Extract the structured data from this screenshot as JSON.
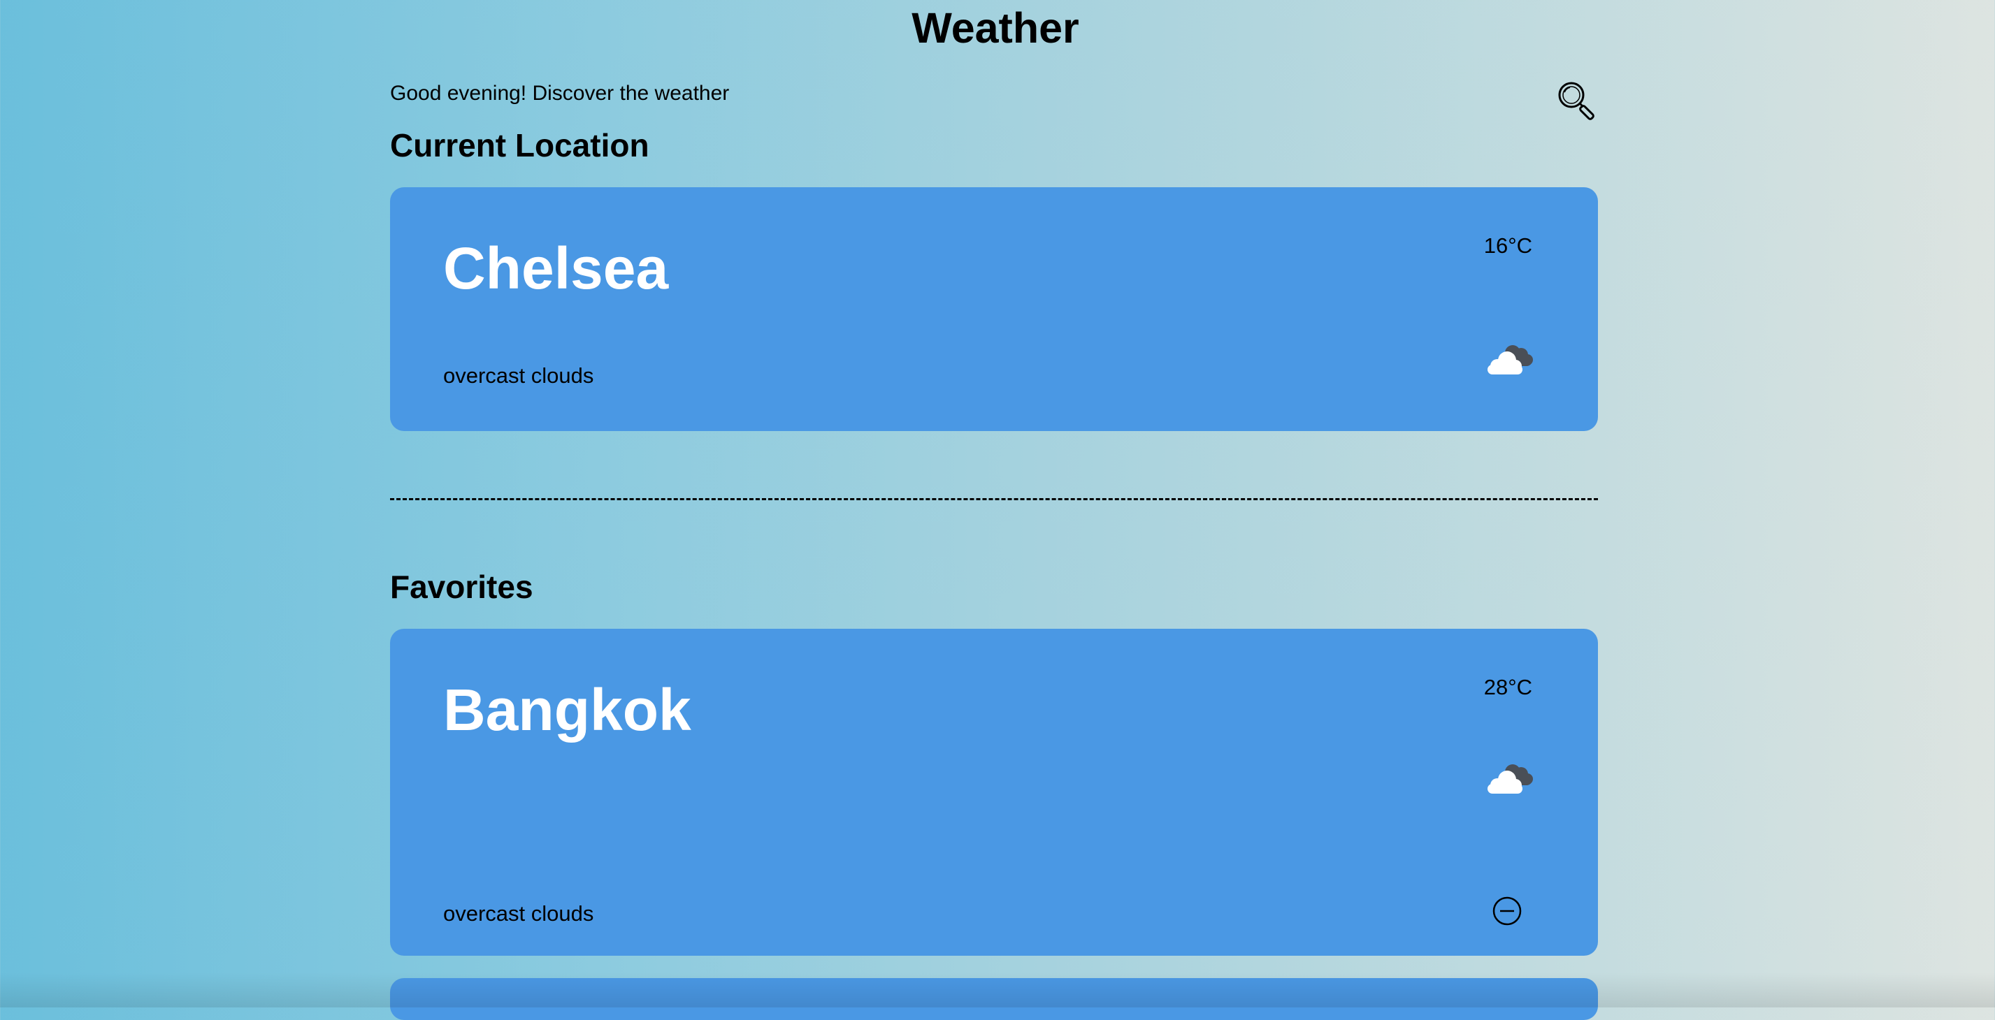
{
  "header": {
    "title": "Weather",
    "greeting": "Good evening! Discover the weather",
    "search_icon": "magnifying-glass-icon"
  },
  "current_location": {
    "section_title": "Current Location",
    "city": "Chelsea",
    "temperature": "16°C",
    "description": "overcast clouds",
    "icon": "overcast-clouds-icon"
  },
  "favorites": {
    "section_title": "Favorites",
    "items": [
      {
        "city": "Bangkok",
        "temperature": "28°C",
        "description": "overcast clouds",
        "icon": "overcast-clouds-icon",
        "remove_icon": "minus-circle-icon"
      }
    ]
  },
  "colors": {
    "card": "#4a98e4",
    "city_text": "#ffffff",
    "background_start": "#6bbfdc",
    "background_end": "#dde4e1"
  }
}
